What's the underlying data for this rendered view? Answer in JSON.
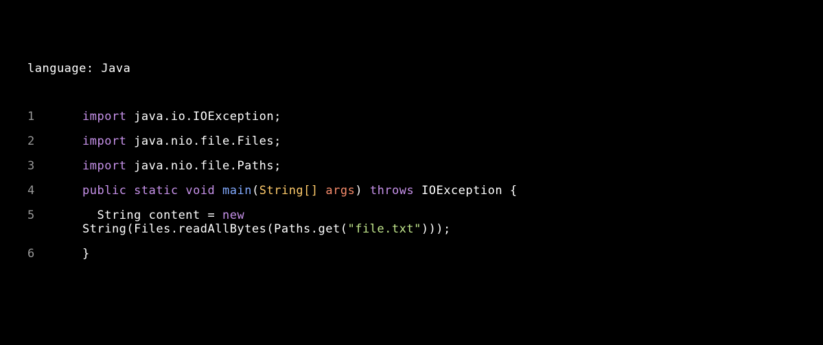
{
  "header": {
    "label": "language:",
    "value": "Java"
  },
  "lines": {
    "l1": "1",
    "l2": "2",
    "l3": "3",
    "l4": "4",
    "l5": "5",
    "l6": "6"
  },
  "code": {
    "import_kw": "import",
    "imp1": " java.io.IOException;",
    "imp2": " java.nio.file.Files;",
    "imp3": " java.nio.file.Paths;",
    "public_kw": "public",
    "static_kw": "static",
    "void_kw": "void",
    "main_fn": "main",
    "lparen": "(",
    "string_type": "String[]",
    "args_param": " args",
    "rparen": ")",
    "throws_kw": "throws",
    "ioexception": " IOException ",
    "lbrace": "{",
    "indent5": "  String content = ",
    "new_kw": "new",
    "line5_wrap": "String(Files.readAllBytes(Paths.get(",
    "str_lit": "\"file.txt\"",
    "close_parens": ")));",
    "rbrace": "}"
  }
}
